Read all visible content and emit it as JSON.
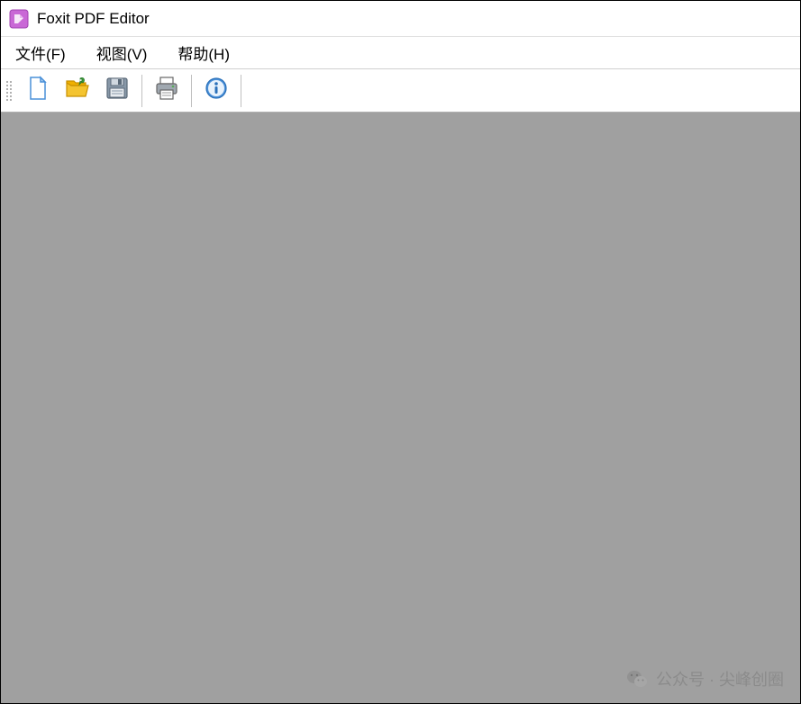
{
  "titlebar": {
    "app_title": "Foxit PDF Editor"
  },
  "menubar": {
    "file": "文件(F)",
    "view": "视图(V)",
    "help": "帮助(H)"
  },
  "toolbar": {
    "new": "new-file-icon",
    "open": "open-folder-icon",
    "save": "save-icon",
    "print": "print-icon",
    "info": "info-icon"
  },
  "watermark": {
    "text": "公众号 · 尖峰创圈"
  }
}
